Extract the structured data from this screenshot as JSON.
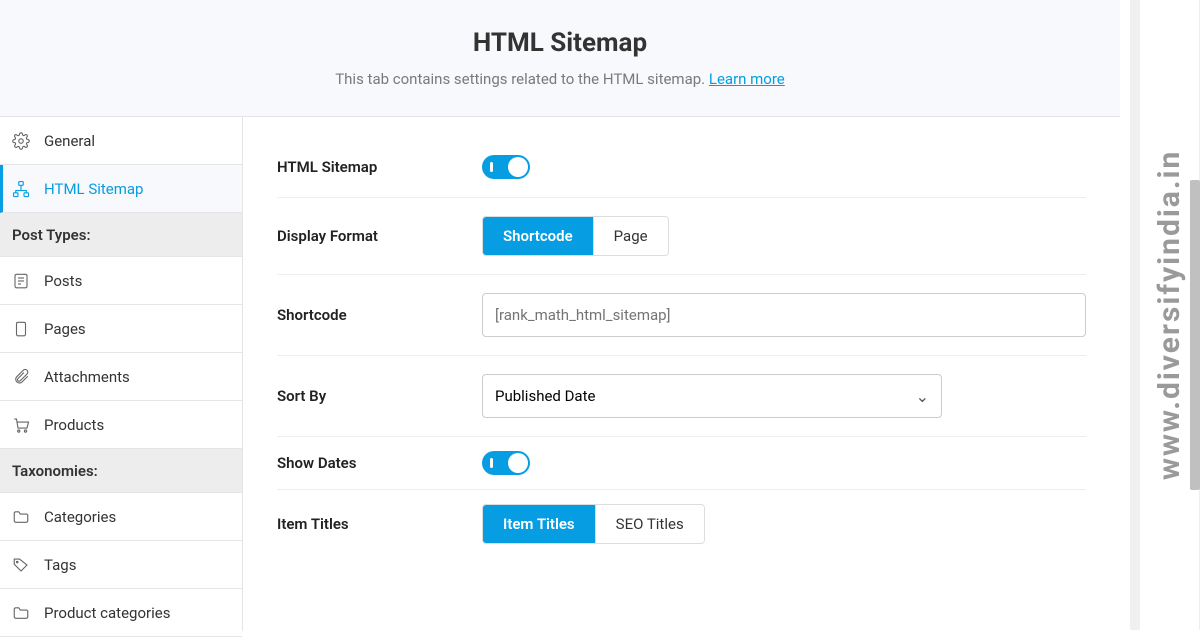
{
  "header": {
    "title": "HTML Sitemap",
    "subtitle": "This tab contains settings related to the HTML sitemap.",
    "learn": "Learn more"
  },
  "sidebar": {
    "general": "General",
    "html": "HTML Sitemap",
    "head_post": "Post Types:",
    "posts": "Posts",
    "pages": "Pages",
    "attach": "Attachments",
    "products": "Products",
    "head_tax": "Taxonomies:",
    "cats": "Categories",
    "tags": "Tags",
    "prodcat": "Product categories"
  },
  "form": {
    "html_label": "HTML Sitemap",
    "disp_label": "Display Format",
    "disp_a": "Shortcode",
    "disp_b": "Page",
    "sc_label": "Shortcode",
    "sc_ph": "[rank_math_html_sitemap]",
    "sort_label": "Sort By",
    "sort_val": "Published Date",
    "dates_label": "Show Dates",
    "titles_label": "Item Titles",
    "titles_a": "Item Titles",
    "titles_b": "SEO Titles"
  },
  "watermark": "www.diversifyindia.in"
}
